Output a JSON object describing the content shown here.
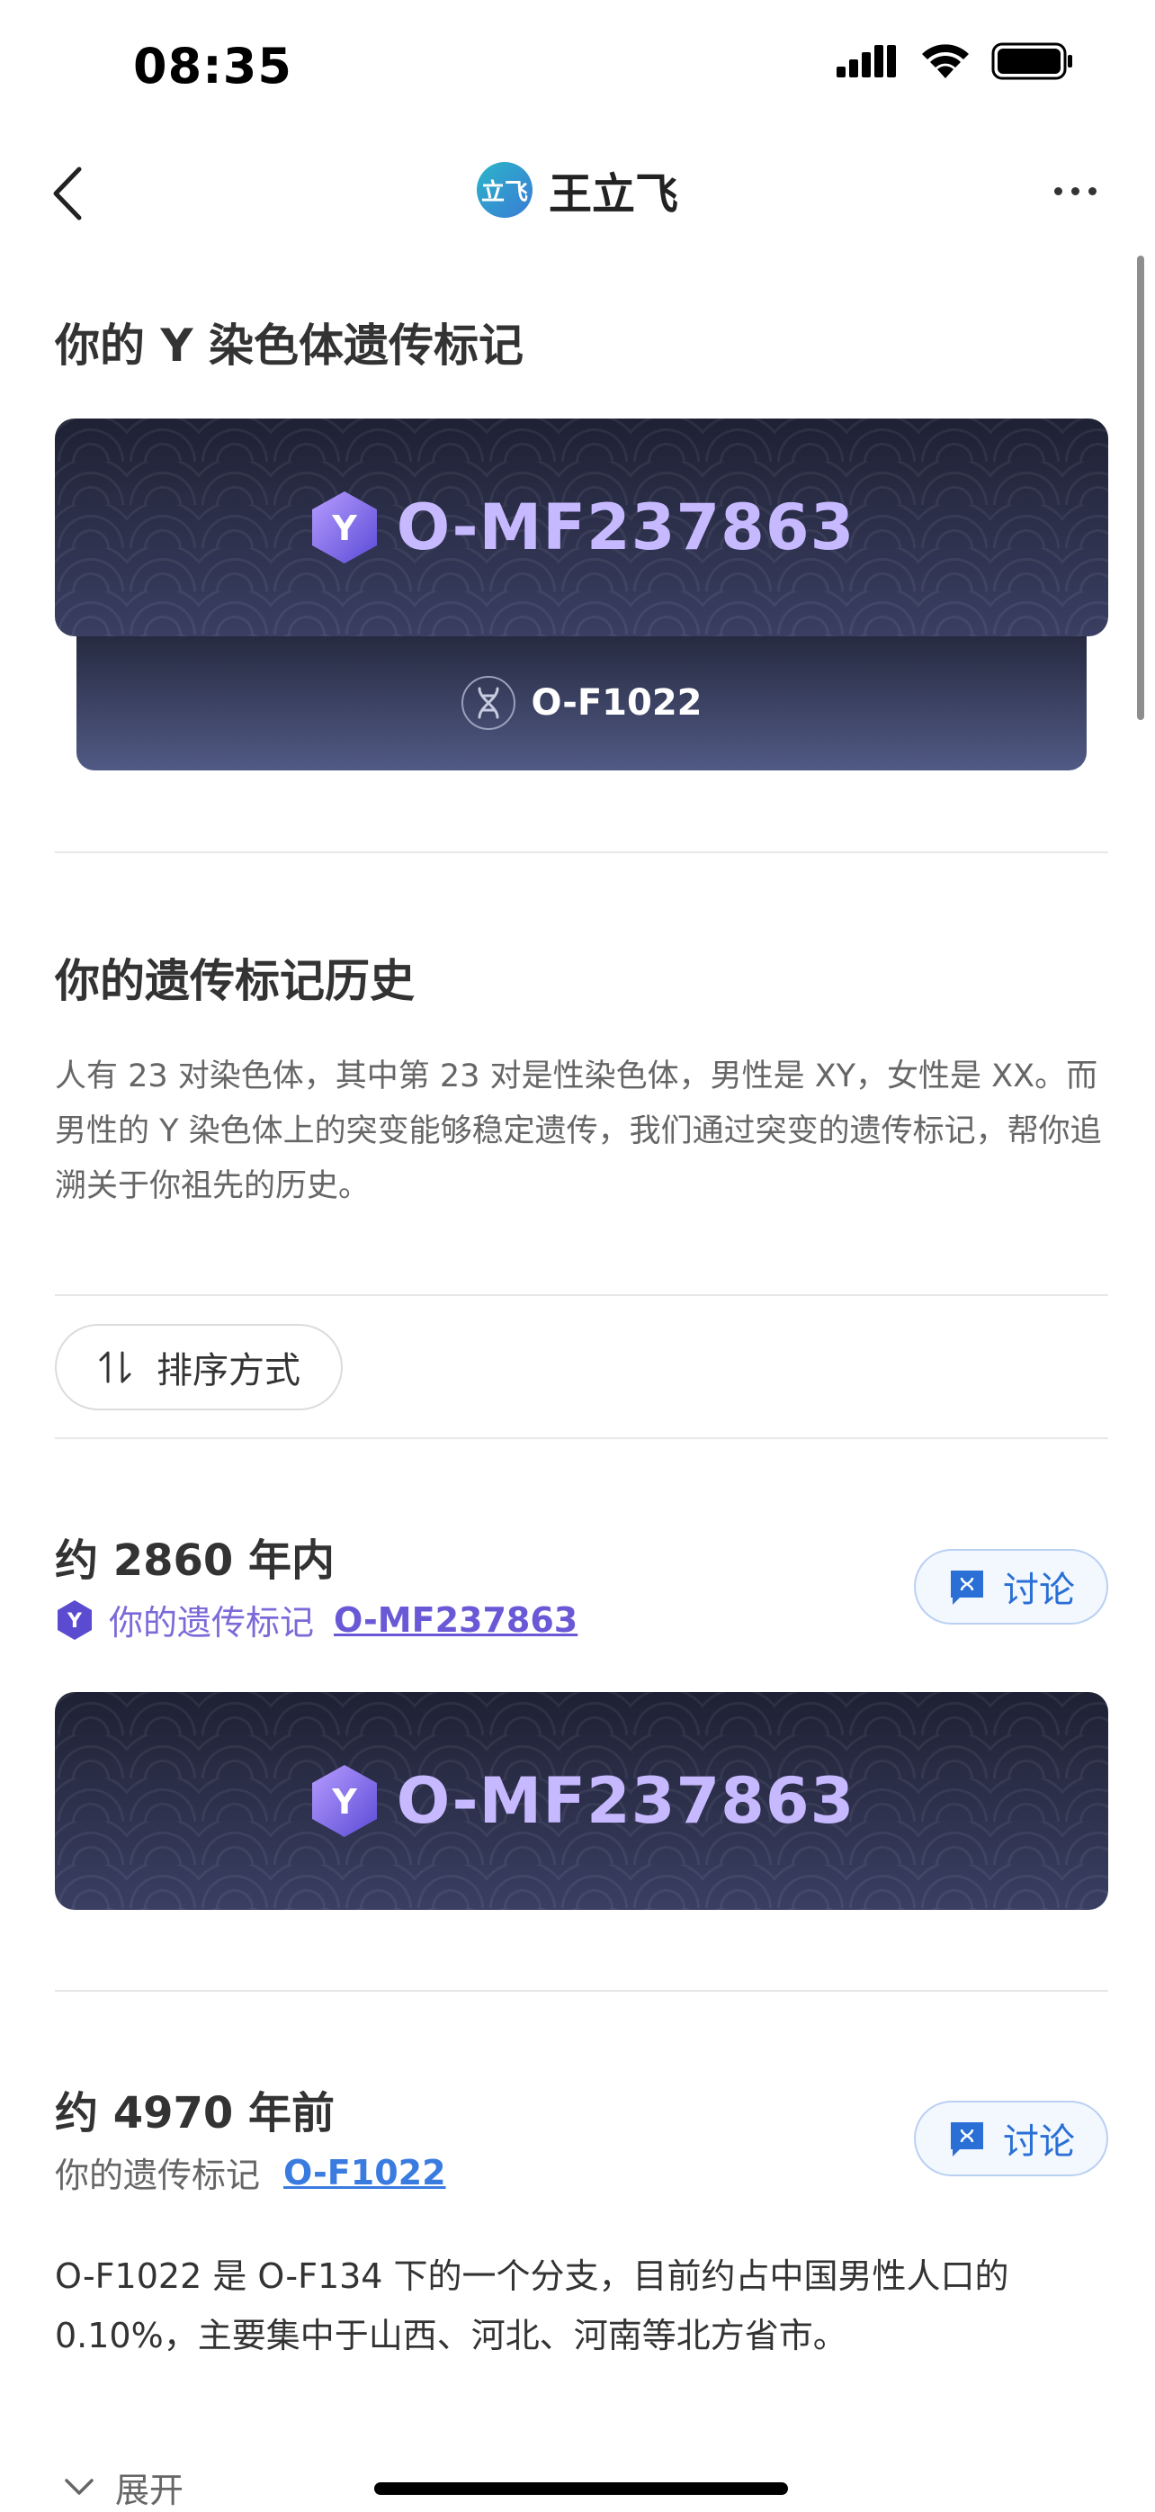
{
  "status_bar": {
    "time": "08:35"
  },
  "nav": {
    "avatar_text": "立飞",
    "name": "王立飞"
  },
  "y_marker_section": {
    "title": "你的 Y 染色体遗传标记",
    "main_marker": "O-MF237863",
    "badge": "Y",
    "parent_marker": "O-F1022"
  },
  "history": {
    "title": "你的遗传标记历史",
    "description": "人有 23 对染色体，其中第 23 对是性染色体，男性是 XY，女性是 XX。而男性的 Y 染色体上的突变能够稳定遗传，我们通过突变的遗传标记，帮你追溯关于你祖先的历史。"
  },
  "sort": {
    "label": "排序方式"
  },
  "entries": [
    {
      "period_prefix": "约",
      "period_num": "2860",
      "period_suffix": "年内",
      "marker_label": "你的遗传标记",
      "marker": "O-MF237863",
      "discuss_label": "讨论",
      "badge": "Y"
    },
    {
      "period_prefix": "约",
      "period_num": "4970",
      "period_suffix": "年前",
      "marker_label": "你的遗传标记",
      "marker": "O-F1022",
      "discuss_label": "讨论",
      "description": "O-F1022 是 O-F134 下的一个分支，目前约占中国男性人口的 0.10%，主要集中于山西、河北、河南等北方省市。"
    }
  ],
  "expand": {
    "label": "展开"
  },
  "colors": {
    "accent_purple": "#7b6ad8",
    "link_blue": "#3a7be0",
    "banner_dark": "#1e2133"
  }
}
